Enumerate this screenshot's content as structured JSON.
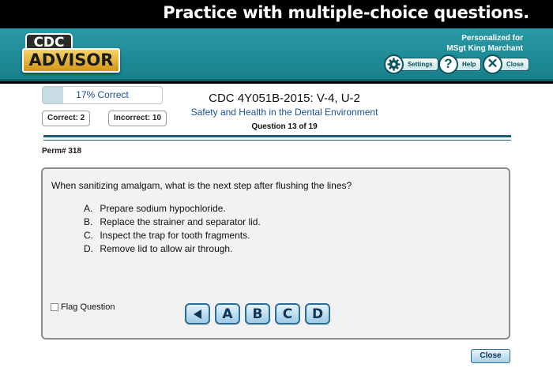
{
  "banner": {
    "text": "Practice with multiple-choice questions."
  },
  "logo": {
    "top": "CDC",
    "main": "ADVISOR"
  },
  "header": {
    "personalized_line1": "Personalized for",
    "personalized_line2": "MSgt King Marchant",
    "settings_label": "Settings",
    "help_label": "Help",
    "close_label": "Close"
  },
  "score": {
    "percent_text": "17% Correct",
    "fraction_correct": 0.17
  },
  "counts": {
    "correct": "Correct: 2",
    "incorrect": "Incorrect: 10"
  },
  "course": {
    "title": "CDC 4Y051B-2015: V-4, U-2",
    "subtitle": "Safety and Health in the Dental Environment",
    "question_number": "Question 13 of 19"
  },
  "perm": "Perm# 318",
  "question": {
    "text": "When sanitizing amalgam, what is the next step after flushing the lines?",
    "options": [
      {
        "letter": "A.",
        "text": "Prepare sodium hypochloride."
      },
      {
        "letter": "B.",
        "text": "Replace the strainer and separator lid."
      },
      {
        "letter": "C.",
        "text": "Inspect the trap for tooth fragments."
      },
      {
        "letter": "D.",
        "text": "Remove lid to allow air through."
      }
    ]
  },
  "flag_label": "Flag Question",
  "answer_buttons": [
    "A",
    "B",
    "C",
    "D"
  ],
  "back_icon": "left-triangle-icon",
  "footer_close": "Close",
  "colors": {
    "teal": "#1e8c98",
    "link_blue": "#1a4f93",
    "gold": "#e2b134"
  }
}
